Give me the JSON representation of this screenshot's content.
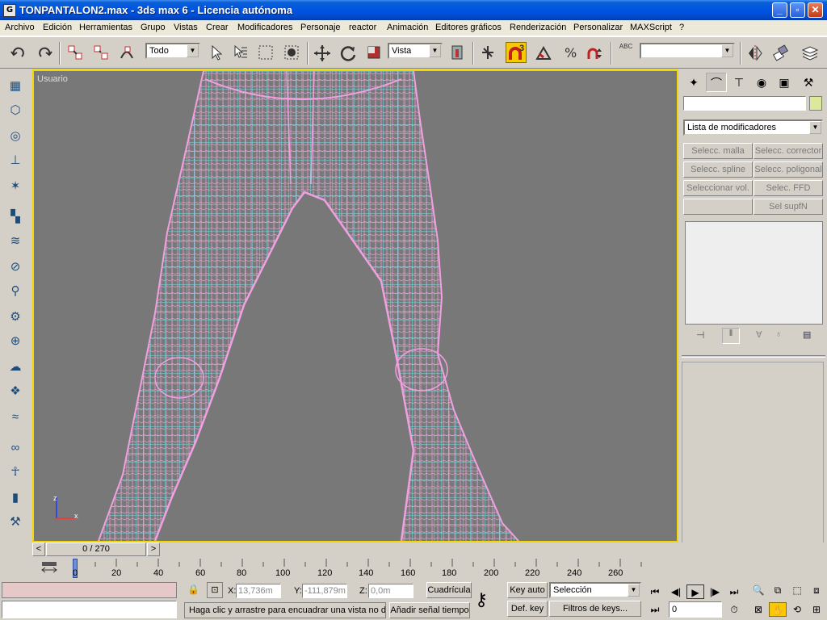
{
  "window": {
    "icon_letter": "G",
    "title": "TONPANTALON2.max - 3ds max 6 - Licencia autónoma",
    "minimize": "_",
    "restore": "▫",
    "close": "✕"
  },
  "menubar": [
    "Archivo",
    "Edición",
    "Herramientas",
    "Grupo",
    "Vistas",
    "Crear",
    "Modificadores",
    "Personaje",
    "reactor",
    "Animación",
    "Editores gráficos",
    "Renderización",
    "Personalizar",
    "MAXScript",
    "?"
  ],
  "toolbar": {
    "selection_filter": "Todo",
    "reference_coord": "Vista",
    "snap_count": "3",
    "named_selection": "",
    "abc_label": "ABC"
  },
  "viewport": {
    "label": "Usuario",
    "axis_z": "z",
    "axis_x": "x"
  },
  "command_panel": {
    "object_name": "",
    "modifier_list": "Lista de modificadores",
    "modifier_buttons": [
      "Selecc. malla",
      "Selecc. corrector",
      "Selecc. spline",
      "Selecc. poligonal",
      "Seleccionar vol.",
      "Selec. FFD",
      "",
      "Sel supfN"
    ]
  },
  "timeline": {
    "slider_label": "0 / 270",
    "prev": "<",
    "next": ">",
    "ticks": [
      "0",
      "20",
      "40",
      "60",
      "80",
      "100",
      "120",
      "140",
      "160",
      "180",
      "200",
      "220",
      "240",
      "260"
    ]
  },
  "status": {
    "x_label": "X:",
    "x_value": "13,736m",
    "y_label": "Y:",
    "y_value": "-111,879m",
    "z_label": "Z:",
    "z_value": "0,0m",
    "grid_label": "Cuadrícula",
    "key_auto": "Key auto",
    "key_mode": "Selección",
    "def_key": "Def. key",
    "key_filters": "Filtros de keys...",
    "prompt": "Haga clic y arrastre para encuadrar una vista no de",
    "add_time_tag": "Añadir señal tiempo",
    "current_frame": "0"
  },
  "colors": {
    "viewport_bg": "#787878",
    "active_border": "#f0d800",
    "wire_pink": "#f0a0e0",
    "wire_cyan": "#5ee8d8",
    "titlebar": "#0054e3"
  }
}
